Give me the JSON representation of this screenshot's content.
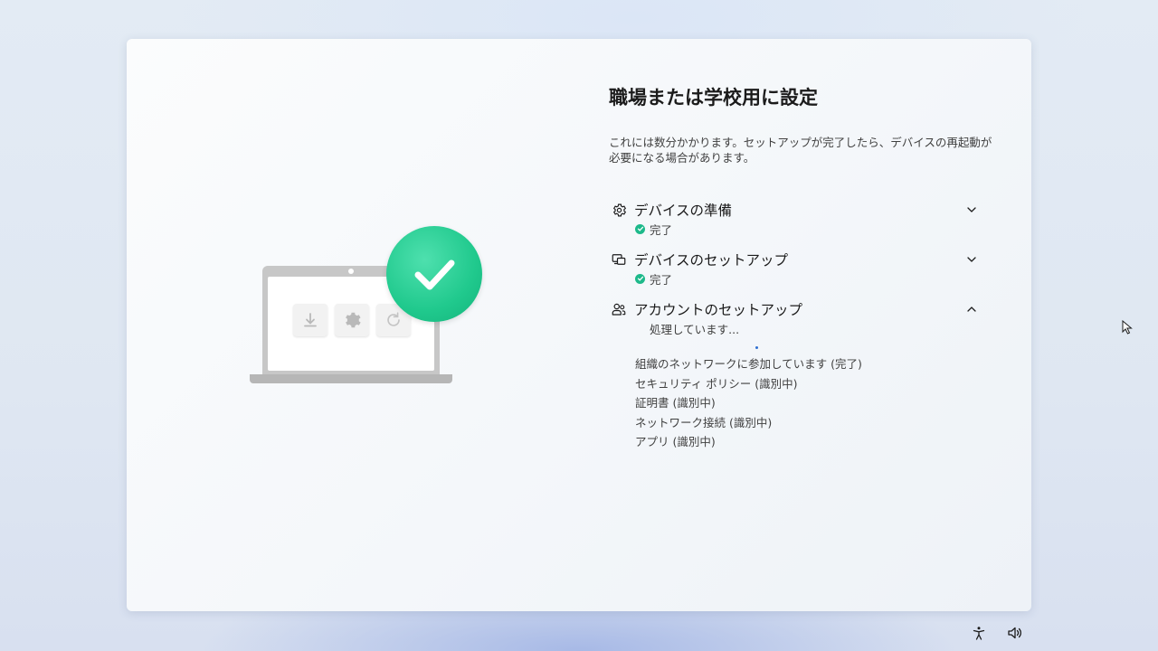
{
  "page": {
    "title": "職場または学校用に設定",
    "description": "これには数分かかります。セットアップが完了したら、デバイスの再起動が必要になる場合があります。"
  },
  "steps": [
    {
      "title": "デバイスの準備",
      "status": "完了",
      "icon": "gear-icon",
      "state": "done",
      "expanded": false
    },
    {
      "title": "デバイスのセットアップ",
      "status": "完了",
      "icon": "devices-icon",
      "state": "done",
      "expanded": false
    },
    {
      "title": "アカウントのセットアップ",
      "status": "処理しています...",
      "icon": "people-icon",
      "state": "in-progress",
      "expanded": true
    }
  ],
  "account_substeps": [
    "組織のネットワークに参加しています (完了)",
    "セキュリティ ポリシー (識別中)",
    "証明書 (識別中)",
    "ネットワーク接続 (識別中)",
    "アプリ (識別中)"
  ],
  "colors": {
    "success": "#1db98a",
    "accent": "#2f6fd1",
    "badge": "#20c98d"
  },
  "system_tray": [
    "accessibility-icon",
    "volume-icon"
  ]
}
